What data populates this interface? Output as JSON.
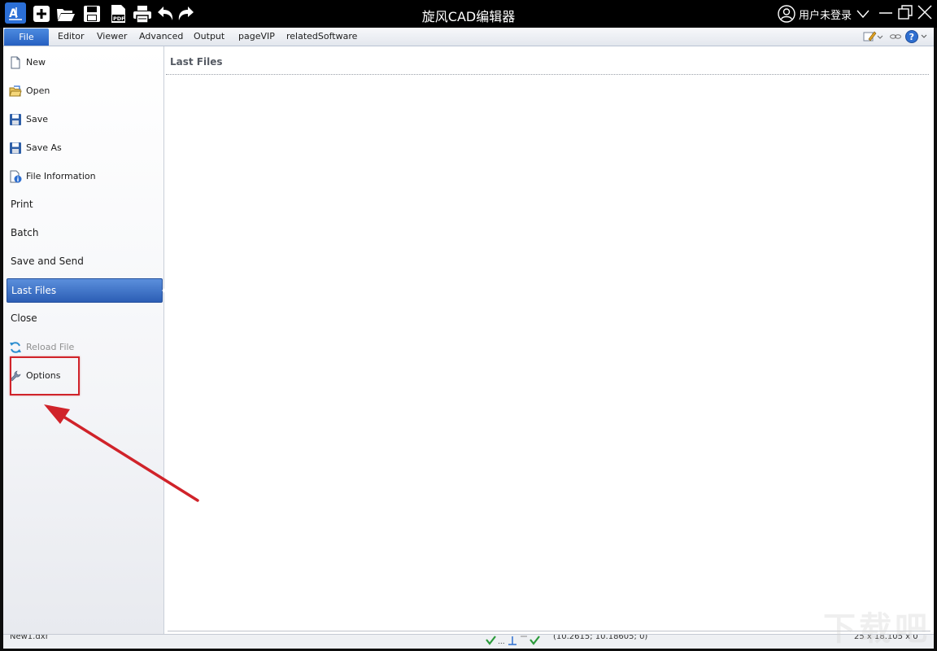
{
  "window": {
    "title": "旋风CAD编辑器",
    "user_label": "用户未登录"
  },
  "icons": {
    "app": "app-logo-icon",
    "new": "new-file-icon",
    "open": "open-folder-icon",
    "save": "save-icon",
    "pdf": "pdf-icon",
    "print": "print-icon",
    "undo": "undo-icon",
    "redo": "redo-icon",
    "user": "user-icon",
    "minimize": "minimize-icon",
    "restore": "restore-icon",
    "close": "close-icon"
  },
  "ribbon": {
    "tabs": [
      "File",
      "Editor",
      "Viewer",
      "Advanced",
      "Output",
      "pageVIP",
      "relatedSoftware"
    ],
    "help_label": "?"
  },
  "sidebar": {
    "items": [
      {
        "label": "New",
        "icon": "new-doc-icon"
      },
      {
        "label": "Open",
        "icon": "open-folder-icon"
      },
      {
        "label": "Save",
        "icon": "floppy-icon"
      },
      {
        "label": "Save As",
        "icon": "floppy-icon"
      },
      {
        "label": "File Information",
        "icon": "file-info-icon"
      },
      {
        "label": "Print"
      },
      {
        "label": "Batch"
      },
      {
        "label": "Save and Send"
      },
      {
        "label": "Last Files",
        "active": true
      },
      {
        "label": "Close"
      },
      {
        "label": "Reload File",
        "icon": "reload-icon",
        "disabled": true
      },
      {
        "label": "Options",
        "icon": "wrench-icon"
      }
    ]
  },
  "main": {
    "title": "Last Files"
  },
  "status": {
    "file": "New1.dxf",
    "coords": "(10.2615; 10.18605; 0)",
    "dims": "25 x 18.105 x 0"
  },
  "watermark": "下载吧",
  "colors": {
    "accent": "#2c5eb5",
    "annotation": "#d0232a"
  }
}
